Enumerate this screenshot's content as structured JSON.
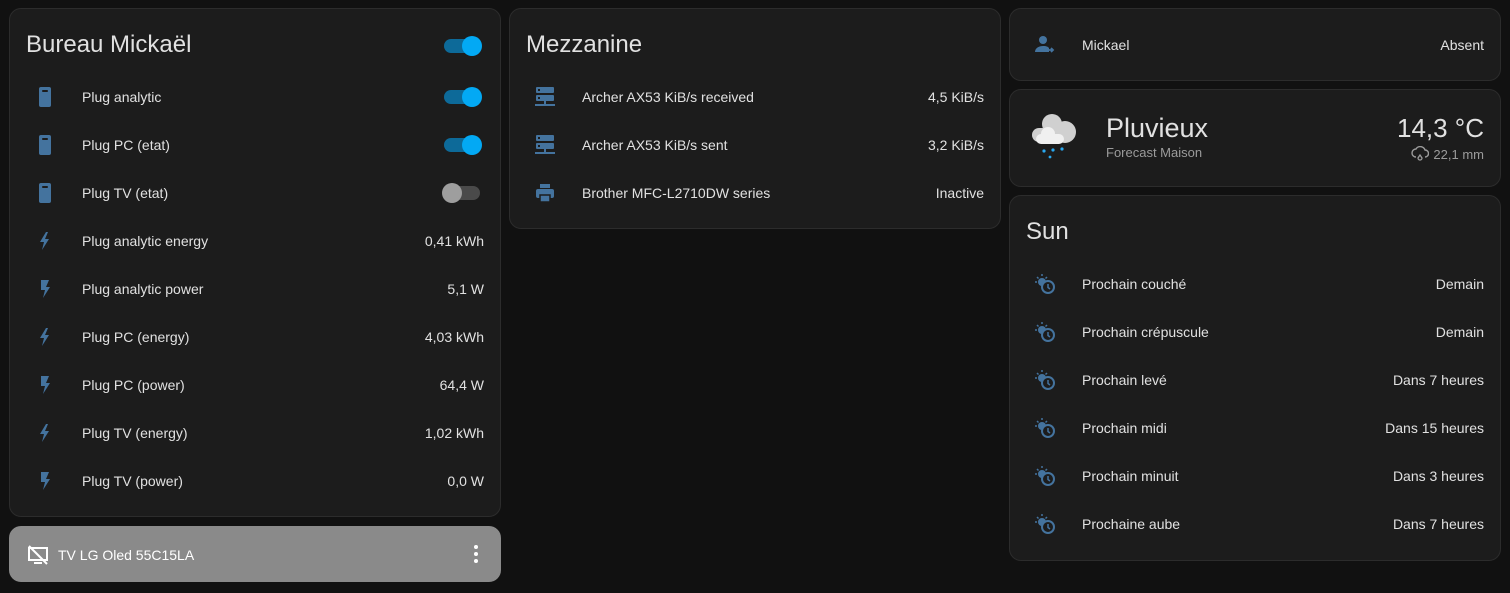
{
  "bureau": {
    "title": "Bureau Mickaël",
    "master_toggle": true,
    "items": [
      {
        "icon": "power-socket-icon",
        "label": "Plug analytic",
        "toggle": true
      },
      {
        "icon": "power-socket-icon",
        "label": "Plug PC (etat)",
        "toggle": true
      },
      {
        "icon": "power-socket-icon",
        "label": "Plug TV (etat)",
        "toggle": false
      },
      {
        "icon": "lightning-icon",
        "label": "Plug analytic energy",
        "value": "0,41 kWh"
      },
      {
        "icon": "flash-icon",
        "label": "Plug analytic power",
        "value": "5,1 W"
      },
      {
        "icon": "lightning-icon",
        "label": "Plug PC (energy)",
        "value": "4,03 kWh"
      },
      {
        "icon": "flash-icon",
        "label": "Plug PC (power)",
        "value": "64,4 W"
      },
      {
        "icon": "lightning-icon",
        "label": "Plug TV (energy)",
        "value": "1,02 kWh"
      },
      {
        "icon": "flash-icon",
        "label": "Plug TV (power)",
        "value": "0,0 W"
      }
    ]
  },
  "tv": {
    "label": "TV LG Oled 55C15LA",
    "icon": "television-off-icon"
  },
  "mezzanine": {
    "title": "Mezzanine",
    "items": [
      {
        "icon": "server-network-icon",
        "label": "Archer AX53 KiB/s received",
        "value": "4,5 KiB/s"
      },
      {
        "icon": "server-network-icon",
        "label": "Archer AX53 KiB/s sent",
        "value": "3,2 KiB/s"
      },
      {
        "icon": "printer-icon",
        "label": "Brother MFC-L2710DW series",
        "value": "Inactive"
      }
    ]
  },
  "person": {
    "name": "Mickael",
    "state": "Absent"
  },
  "weather": {
    "condition": "Pluvieux",
    "name": "Forecast Maison",
    "temperature": "14,3 °C",
    "precipitation": "22,1 mm"
  },
  "sun": {
    "title": "Sun",
    "items": [
      {
        "label": "Prochain couché",
        "value": "Demain"
      },
      {
        "label": "Prochain crépuscule",
        "value": "Demain"
      },
      {
        "label": "Prochain levé",
        "value": "Dans 7 heures"
      },
      {
        "label": "Prochain midi",
        "value": "Dans 15 heures"
      },
      {
        "label": "Prochain minuit",
        "value": "Dans 3 heures"
      },
      {
        "label": "Prochaine aube",
        "value": "Dans 7 heures"
      }
    ]
  },
  "colors": {
    "icon": "#44739e",
    "accent": "#03a9f4",
    "card": "#1c1c1c",
    "background": "#111111"
  }
}
